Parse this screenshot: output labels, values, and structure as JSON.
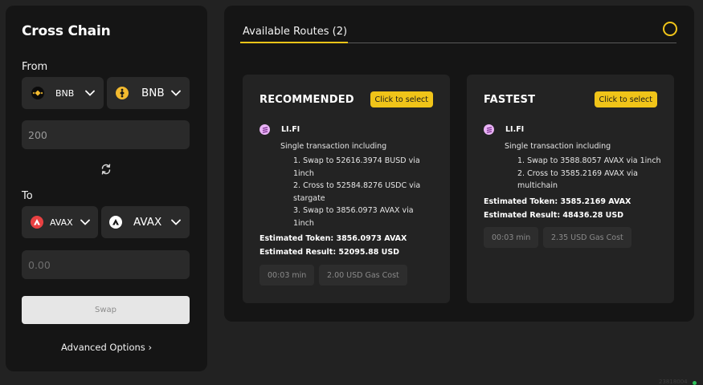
{
  "left": {
    "title": "Cross Chain",
    "from_label": "From",
    "from_chain": {
      "name": "BNB",
      "icon": "bnb-chain-icon"
    },
    "from_token": {
      "name": "BNB",
      "icon": "bnb-token-icon"
    },
    "from_amount": "200",
    "to_label": "To",
    "to_chain": {
      "name": "AVAX",
      "icon": "avalanche-chain-icon"
    },
    "to_token": {
      "name": "AVAX",
      "icon": "avalanche-token-icon"
    },
    "to_amount_placeholder": "0.00",
    "swap_label": "Swap",
    "advanced_label": "Advanced Options ›"
  },
  "routes": {
    "tab_label": "Available Routes (2)",
    "accent": "#f0c419",
    "cards": [
      {
        "title": "RECOMMENDED",
        "select_label": "Click to select",
        "provider": "LI.FI",
        "description": "Single transaction including",
        "steps": [
          [
            "1. Swap to 52616.3974 BUSD via",
            "1inch"
          ],
          [
            "2. Cross to 52584.8276 USDC via",
            "stargate"
          ],
          [
            "3. Swap to 3856.0973 AVAX via",
            "1inch"
          ]
        ],
        "est_token": "Estimated Token: 3856.0973 AVAX",
        "est_result": "Estimated Result: 52095.88 USD",
        "time": "00:03 min",
        "gas": "2.00 USD Gas Cost"
      },
      {
        "title": "FASTEST",
        "select_label": "Click to select",
        "provider": "LI.FI",
        "description": "Single transaction including",
        "steps": [
          [
            "1. Swap to 3588.8057 AVAX via 1inch"
          ],
          [
            "2. Cross to 3585.2169 AVAX via",
            "multichain"
          ]
        ],
        "est_token": "Estimated Token: 3585.2169 AVAX",
        "est_result": "Estimated Result: 48436.28 USD",
        "time": "00:03 min",
        "gas": "2.35 USD Gas Cost"
      }
    ]
  },
  "footer": {
    "block": "23818004"
  }
}
